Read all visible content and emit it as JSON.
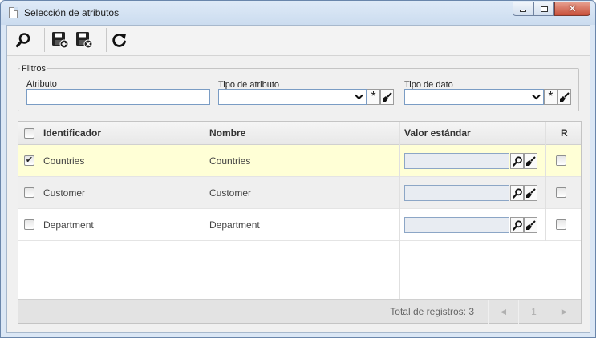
{
  "window": {
    "title": "Selección de atributos",
    "close_glyph": "✕"
  },
  "toolbar": {
    "buttons": [
      {
        "icon": "search-icon",
        "label": "Buscar"
      },
      {
        "icon": "save-new-icon",
        "label": "Guardar y nuevo"
      },
      {
        "icon": "save-close-icon",
        "label": "Guardar y cerrar"
      },
      {
        "icon": "refresh-icon",
        "label": "Actualizar"
      }
    ]
  },
  "filters": {
    "legend": "Filtros",
    "attribute_label": "Atributo",
    "attribute_value": "",
    "attribute_type_label": "Tipo de atributo",
    "attribute_type_value": "",
    "data_type_label": "Tipo de dato",
    "data_type_value": "",
    "asterisk": "*"
  },
  "grid": {
    "columns": {
      "identifier": "Identificador",
      "name": "Nombre",
      "default_value": "Valor estándar",
      "required": "R"
    },
    "rows": [
      {
        "identifier": "Countries",
        "name": "Countries",
        "value": "",
        "selected": true,
        "required": false
      },
      {
        "identifier": "Customer",
        "name": "Customer",
        "value": "",
        "selected": false,
        "required": false
      },
      {
        "identifier": "Department",
        "name": "Department",
        "value": "",
        "selected": false,
        "required": false
      }
    ],
    "footer": {
      "total_text": "Total de registros: 3",
      "page": "1",
      "prev": "◄",
      "next": "►"
    }
  },
  "colors": {
    "title_bg": "#cbdcef",
    "selected_row": "#ffffd6",
    "close_button": "#c8503a",
    "input_border": "#7a9cc4"
  }
}
